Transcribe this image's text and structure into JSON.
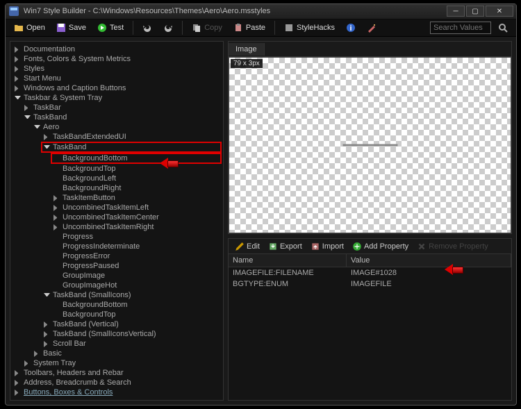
{
  "window": {
    "title": "Win7 Style Builder - C:\\Windows\\Resources\\Themes\\Aero\\Aero.msstyles"
  },
  "toolbar": {
    "open": "Open",
    "save": "Save",
    "test": "Test",
    "copy": "Copy",
    "paste": "Paste",
    "stylehacks": "StyleHacks",
    "search_placeholder": "Search Values"
  },
  "tree": {
    "documentation": "Documentation",
    "fonts": "Fonts, Colors & System Metrics",
    "styles": "Styles",
    "startmenu": "Start Menu",
    "windows_caption": "Windows and Caption Buttons",
    "taskbar_tray": "Taskbar & System Tray",
    "taskbar": "TaskBar",
    "taskband": "TaskBand",
    "aero": "Aero",
    "taskband_ext": "TaskBandExtendedUI",
    "taskband_inner": "TaskBand",
    "bg_bottom": "BackgroundBottom",
    "bg_top": "BackgroundTop",
    "bg_left": "BackgroundLeft",
    "bg_right": "BackgroundRight",
    "taskitem_btn": "TaskItemButton",
    "uncomb_left": "UncombinedTaskItemLeft",
    "uncomb_center": "UncombinedTaskItemCenter",
    "uncomb_right": "UncombinedTaskItemRight",
    "progress": "Progress",
    "progress_ind": "ProgressIndeterminate",
    "progress_err": "ProgressError",
    "progress_paused": "ProgressPaused",
    "group_image": "GroupImage",
    "group_image_hot": "GroupImageHot",
    "taskband_small": "TaskBand (SmallIcons)",
    "bg_bottom2": "BackgroundBottom",
    "bg_top2": "BackgroundTop",
    "taskband_vert": "TaskBand (Vertical)",
    "taskband_smallv": "TaskBand (SmallIconsVertical)",
    "scrollbar": "Scroll Bar",
    "basic": "Basic",
    "system_tray": "System Tray",
    "toolbars_rebar": "Toolbars, Headers and Rebar",
    "address_search": "Address, Breadcrumb & Search",
    "buttons_boxes": "Buttons, Boxes & Controls"
  },
  "image": {
    "tab": "Image",
    "dimensions": "79 x 3px"
  },
  "props": {
    "edit": "Edit",
    "export": "Export",
    "import": "Import",
    "add": "Add Property",
    "remove": "Remove Property",
    "col_name": "Name",
    "col_value": "Value",
    "rows": [
      {
        "name": "IMAGEFILE:FILENAME",
        "value": "IMAGE#1028"
      },
      {
        "name": "BGTYPE:ENUM",
        "value": "IMAGEFILE"
      }
    ]
  }
}
